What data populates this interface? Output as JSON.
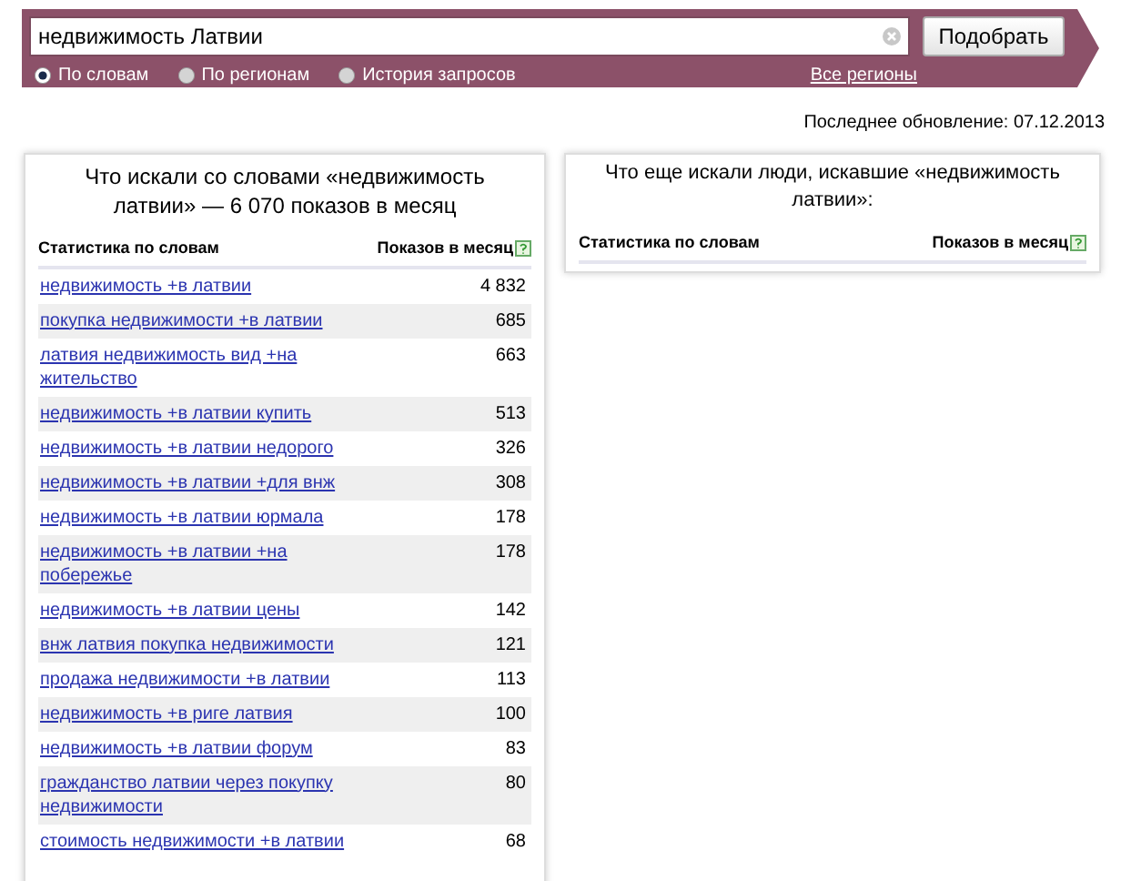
{
  "search": {
    "value": "недвижимость Латвии",
    "button": "Подобрать"
  },
  "modes": [
    {
      "label": "По словам",
      "selected": true
    },
    {
      "label": "По регионам",
      "selected": false
    },
    {
      "label": "История запросов",
      "selected": false
    }
  ],
  "regions_link": "Все регионы",
  "last_update": "Последнее обновление: 07.12.2013",
  "left_panel": {
    "title": "Что искали со словами «недвижимость латвии» — 6 070 показов в месяц",
    "columns": [
      "Статистика по словам",
      "Показов в месяц"
    ],
    "rows": [
      {
        "phrase": "недвижимость +в латвии",
        "count": "4 832"
      },
      {
        "phrase": "покупка недвижимости +в латвии",
        "count": "685"
      },
      {
        "phrase": "латвия недвижимость вид +на жительство",
        "count": "663"
      },
      {
        "phrase": "недвижимость +в латвии купить",
        "count": "513"
      },
      {
        "phrase": "недвижимость +в латвии недорого",
        "count": "326"
      },
      {
        "phrase": "недвижимость +в латвии +для внж",
        "count": "308"
      },
      {
        "phrase": "недвижимость +в латвии юрмала",
        "count": "178"
      },
      {
        "phrase": "недвижимость +в латвии +на побережье",
        "count": "178"
      },
      {
        "phrase": "недвижимость +в латвии цены",
        "count": "142"
      },
      {
        "phrase": "внж латвия покупка недвижимости",
        "count": "121"
      },
      {
        "phrase": "продажа недвижимости +в латвии",
        "count": "113"
      },
      {
        "phrase": "недвижимость +в риге латвия",
        "count": "100"
      },
      {
        "phrase": "недвижимость +в латвии форум",
        "count": "83"
      },
      {
        "phrase": "гражданство латвии через покупку недвижимости",
        "count": "80"
      },
      {
        "phrase": "стоимость недвижимости +в латвии",
        "count": "68"
      }
    ]
  },
  "right_panel": {
    "title": "Что еще искали люди, искавшие «недвижимость латвии»:",
    "columns": [
      "Статистика по словам",
      "Показов в месяц"
    ]
  }
}
